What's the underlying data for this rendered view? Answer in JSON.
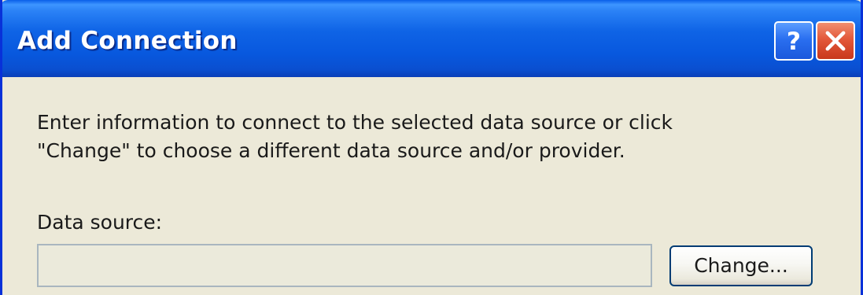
{
  "window": {
    "title": "Add Connection",
    "title_buttons": [
      {
        "name": "help",
        "icon": "question-mark-icon"
      },
      {
        "name": "close",
        "icon": "close-x-icon"
      }
    ]
  },
  "content": {
    "description_lines": [
      "Enter information to connect to the selected data source or click",
      "\"Change\" to choose a different data source and/or provider."
    ],
    "data_source": {
      "label": "Data source:",
      "value": "",
      "change_button_label": "Change..."
    }
  },
  "colors": {
    "titlebar": "#0a5fe8",
    "dialog_background": "#ece9d8",
    "close_button": "#e3583a",
    "help_button": "#2a6ff0"
  }
}
